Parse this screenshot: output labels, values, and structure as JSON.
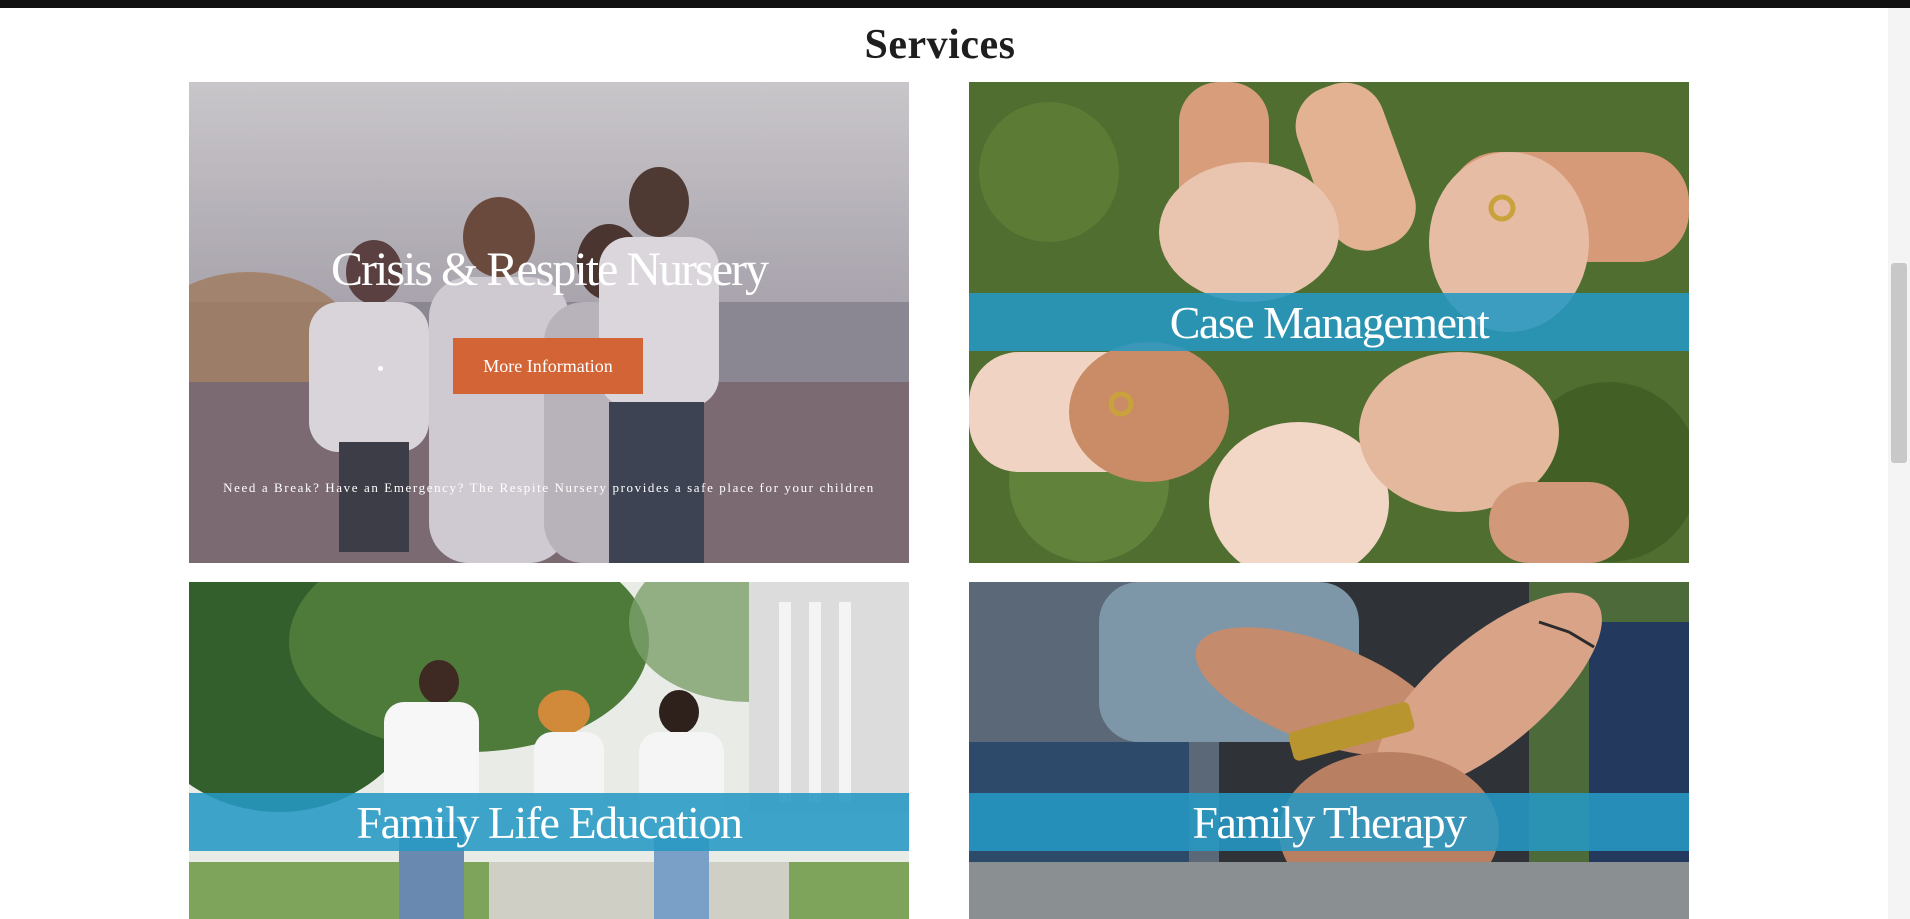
{
  "page": {
    "heading": "Services"
  },
  "cards": [
    {
      "title": "Crisis & Respite Nursery",
      "button_label": "More Information",
      "caption": "Need a Break? Have an Emergency? The Respite Nursery provides a safe place for your children"
    },
    {
      "title": "Case Management"
    },
    {
      "title": "Family Life Education"
    },
    {
      "title": "Family Therapy"
    }
  ],
  "colors": {
    "band": "#2699c4",
    "button": "#d36435",
    "text_dark": "#1e1e1e"
  }
}
